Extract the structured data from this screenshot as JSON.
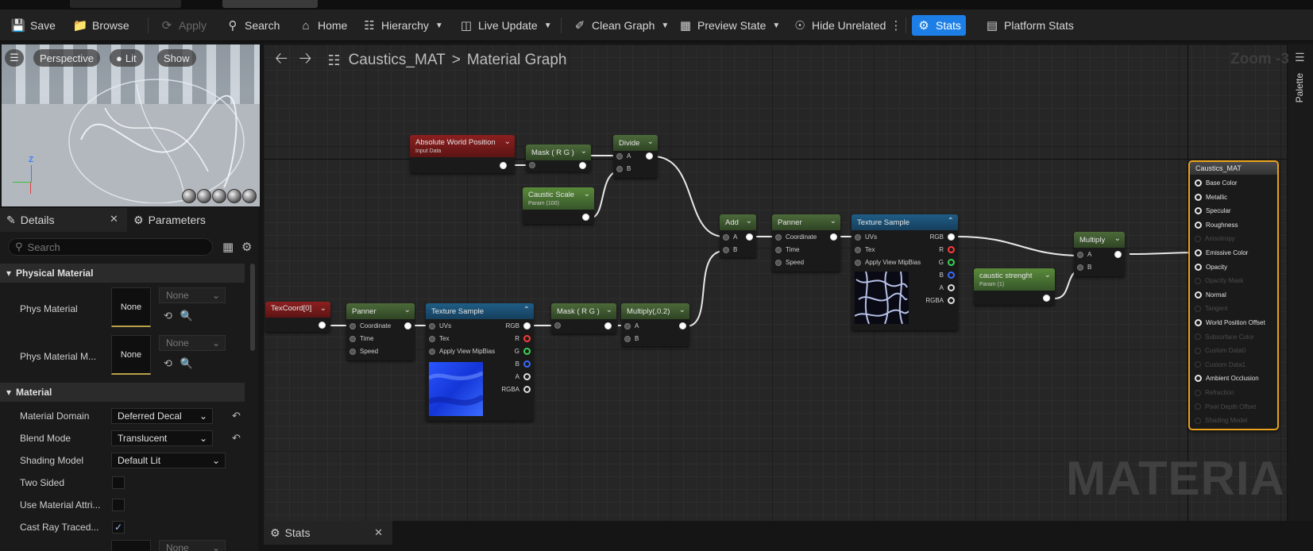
{
  "toolbar": {
    "save": "Save",
    "browse": "Browse",
    "apply": "Apply",
    "search": "Search",
    "home": "Home",
    "hierarchy": "Hierarchy",
    "live_update": "Live Update",
    "clean_graph": "Clean Graph",
    "preview_state": "Preview State",
    "hide_unrelated": "Hide Unrelated",
    "stats": "Stats",
    "platform_stats": "Platform Stats"
  },
  "viewport": {
    "perspective": "Perspective",
    "lit": "Lit",
    "show": "Show"
  },
  "details": {
    "tab_details": "Details",
    "tab_parameters": "Parameters",
    "search_placeholder": "Search",
    "section_physical": "Physical Material",
    "phys_material": "Phys Material",
    "phys_material_m": "Phys Material M...",
    "none": "None",
    "section_material": "Material",
    "material_domain": "Material Domain",
    "material_domain_value": "Deferred Decal",
    "blend_mode": "Blend Mode",
    "blend_mode_value": "Translucent",
    "shading_model": "Shading Model",
    "shading_model_value": "Default Lit",
    "two_sided": "Two Sided",
    "use_material_attri": "Use Material Attri...",
    "cast_ray_traced": "Cast Ray Traced..."
  },
  "graph": {
    "material_name": "Caustics_MAT",
    "breadcrumb_sep": ">",
    "graph_name": "Material Graph",
    "zoom": "Zoom -3",
    "watermark": "MATERIAL"
  },
  "nodes": {
    "abs_world_pos": {
      "title": "Absolute World Position",
      "sub": "Input Data"
    },
    "mask_rg_top": {
      "title": "Mask ( R G )"
    },
    "divide": {
      "title": "Divide",
      "pin_a": "A",
      "pin_b": "B"
    },
    "caustic_scale": {
      "title": "Caustic Scale",
      "sub": "Param (100)"
    },
    "add": {
      "title": "Add",
      "pin_a": "A",
      "pin_b": "B"
    },
    "panner_top": {
      "title": "Panner",
      "coordinate": "Coordinate",
      "time": "Time",
      "speed": "Speed"
    },
    "tex_top": {
      "title": "Texture Sample",
      "uvs": "UVs",
      "tex": "Tex",
      "apply": "Apply View MipBias",
      "rgb": "RGB",
      "r": "R",
      "g": "G",
      "b": "B",
      "a": "A",
      "rgba": "RGBA"
    },
    "caustic_strength": {
      "title": "caustic strenght",
      "sub": "Param (1)"
    },
    "multiply_right": {
      "title": "Multiply",
      "pin_a": "A",
      "pin_b": "B"
    },
    "texcoord": {
      "title": "TexCoord[0]"
    },
    "panner_bottom": {
      "title": "Panner",
      "coordinate": "Coordinate",
      "time": "Time",
      "speed": "Speed"
    },
    "tex_bottom": {
      "title": "Texture Sample",
      "uvs": "UVs",
      "tex": "Tex",
      "apply": "Apply View MipBias",
      "rgb": "RGB",
      "r": "R",
      "g": "G",
      "b": "B",
      "a": "A",
      "rgba": "RGBA"
    },
    "mask_rg_bottom": {
      "title": "Mask ( R G )"
    },
    "multiply_02": {
      "title": "Multiply(,0.2)",
      "pin_a": "A",
      "pin_b": "B"
    }
  },
  "result_node": {
    "title": "Caustics_MAT",
    "pins": [
      {
        "label": "Base Color",
        "enabled": true
      },
      {
        "label": "Metallic",
        "enabled": true
      },
      {
        "label": "Specular",
        "enabled": true
      },
      {
        "label": "Roughness",
        "enabled": true
      },
      {
        "label": "Anisotropy",
        "enabled": false
      },
      {
        "label": "Emissive Color",
        "enabled": true
      },
      {
        "label": "Opacity",
        "enabled": true
      },
      {
        "label": "Opacity Mask",
        "enabled": false
      },
      {
        "label": "Normal",
        "enabled": true
      },
      {
        "label": "Tangent",
        "enabled": false
      },
      {
        "label": "World Position Offset",
        "enabled": true
      },
      {
        "label": "Subsurface Color",
        "enabled": false
      },
      {
        "label": "Custom Data0",
        "enabled": false
      },
      {
        "label": "Custom Data1",
        "enabled": false
      },
      {
        "label": "Ambient Occlusion",
        "enabled": true
      },
      {
        "label": "Refraction",
        "enabled": false
      },
      {
        "label": "Pixel Depth Offset",
        "enabled": false
      },
      {
        "label": "Shading Model",
        "enabled": false
      }
    ]
  },
  "palette": {
    "label": "Palette"
  },
  "stats_panel": {
    "tab": "Stats"
  },
  "colors": {
    "accent": "#1d7fe6",
    "result_border": "#e8a21c",
    "red_pin": "#ff3b3b",
    "green_pin": "#39d353",
    "blue_pin": "#3b6bff"
  }
}
